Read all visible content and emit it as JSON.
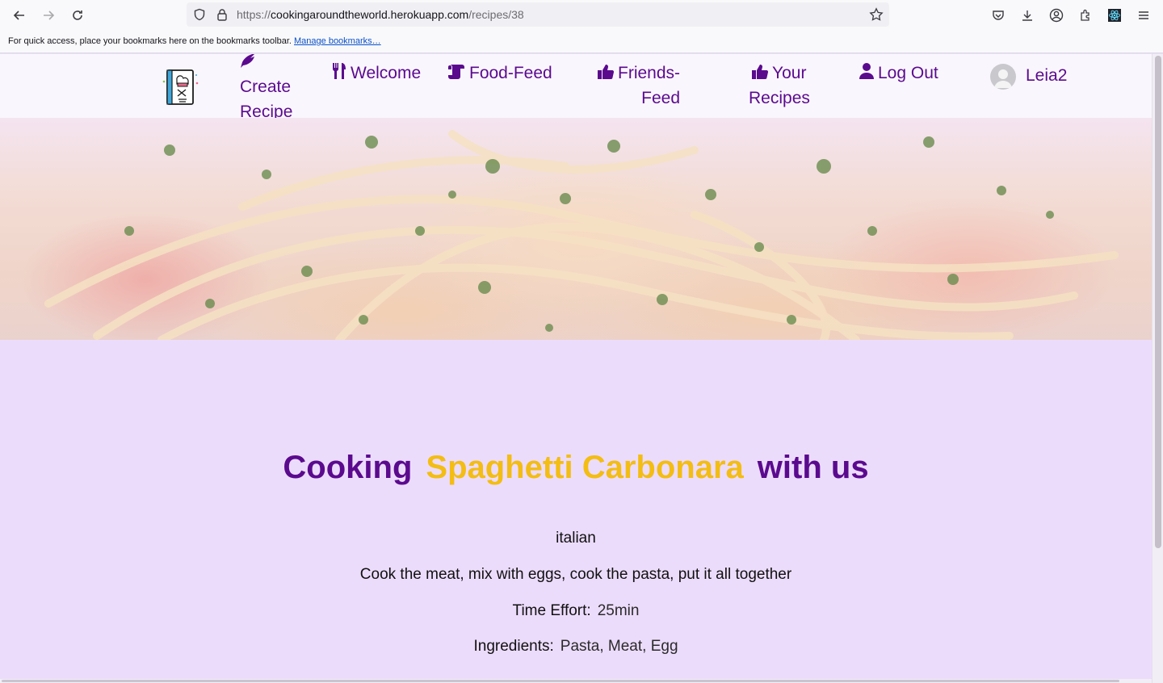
{
  "browser": {
    "url_prefix": "https://",
    "url_host": "cookingaroundtheworld.herokuapp.com",
    "url_path": "/recipes/38",
    "bookmarks_message": "For quick access, place your bookmarks here on the bookmarks toolbar.",
    "bookmarks_link": "Manage bookmarks…"
  },
  "nav": {
    "create_line1": "Create",
    "create_line2": "Recipe",
    "welcome": "Welcome",
    "food_feed": "Food-Feed",
    "friends_line1": "Friends-",
    "friends_line2": "Feed",
    "your_line1": "Your",
    "your_line2": "Recipes",
    "logout": "Log Out",
    "username": "Leia2"
  },
  "recipe": {
    "title_prefix": "Cooking",
    "title_name": "Spaghetti Carbonara",
    "title_suffix": "with us",
    "cuisine": "italian",
    "description": "Cook the meat, mix with eggs, cook the pasta, put it all together",
    "time_label": "Time Effort:",
    "time_value": "25min",
    "ingredients_label": "Ingredients:",
    "ingredients_value": "Pasta, Meat, Egg"
  },
  "colors": {
    "brand_purple": "#5b0a8e",
    "accent_yellow": "#f3bd13",
    "page_background": "#ecdcfc"
  },
  "icons": [
    "back-arrow-icon",
    "forward-arrow-icon",
    "reload-icon",
    "shield-icon",
    "lock-icon",
    "bookmark-star-icon",
    "pocket-icon",
    "download-icon",
    "account-icon",
    "extensions-icon",
    "react-devtools-icon",
    "menu-icon",
    "feather-icon",
    "utensils-icon",
    "scroll-icon",
    "thumbs-up-icon",
    "user-icon"
  ]
}
